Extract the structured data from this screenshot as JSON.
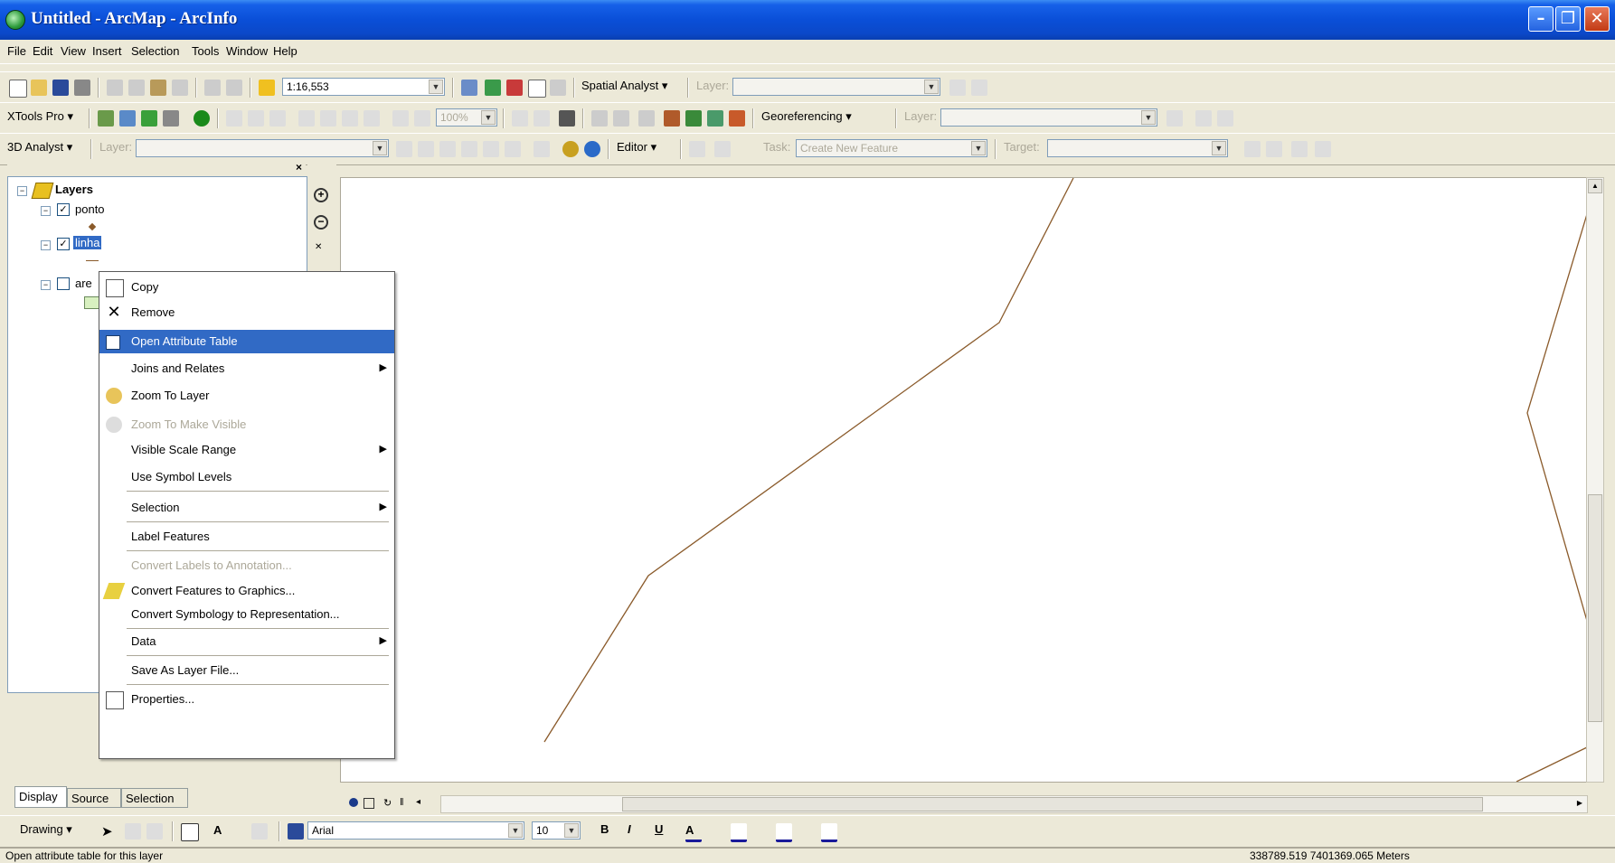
{
  "window": {
    "title": "Untitled - ArcMap - ArcInfo"
  },
  "menubar": [
    "File",
    "Edit",
    "View",
    "Insert",
    "Selection",
    "Tools",
    "Window",
    "Help"
  ],
  "standard_toolbar": {
    "scale": "1:16,553",
    "spatial_analyst": "Spatial Analyst",
    "layer_label": "Layer:"
  },
  "xtools_toolbar": {
    "xtools": "XTools Pro",
    "zoom_pct": "100%",
    "georeferencing": "Georeferencing",
    "layer_label": "Layer:"
  },
  "analyst_toolbar": {
    "analyst": "3D Analyst",
    "layer_label": "Layer:",
    "editor": "Editor",
    "task_label": "Task:",
    "task_value": "Create New Feature",
    "target_label": "Target:"
  },
  "toc": {
    "root": "Layers",
    "layers": [
      {
        "name": "ponto",
        "checked": true
      },
      {
        "name": "linha",
        "checked": true,
        "selected": true
      },
      {
        "name": "are",
        "checked": false
      }
    ],
    "tabs": [
      "Display",
      "Source",
      "Selection"
    ]
  },
  "context_menu": {
    "items": [
      {
        "label": "Copy",
        "icon": "copy-icon"
      },
      {
        "label": "Remove",
        "icon": "remove-x-icon"
      },
      {
        "label": "Open Attribute Table",
        "icon": "table-icon",
        "highlighted": true
      },
      {
        "label": "Joins and Relates",
        "submenu": true
      },
      {
        "label": "Zoom To Layer",
        "icon": "zoom-to-layer-icon"
      },
      {
        "label": "Zoom To Make Visible",
        "icon": "zoom-visible-icon",
        "disabled": true
      },
      {
        "label": "Visible Scale Range",
        "submenu": true
      },
      {
        "label": "Use Symbol Levels"
      },
      {
        "label": "Selection",
        "submenu": true
      },
      {
        "label": "Label Features"
      },
      {
        "label": "Convert Labels to Annotation...",
        "disabled": true
      },
      {
        "label": "Convert Features to Graphics...",
        "icon": "convert-graphics-icon"
      },
      {
        "label": "Convert Symbology to Representation..."
      },
      {
        "label": "Data",
        "submenu": true
      },
      {
        "label": "Save As Layer File..."
      },
      {
        "label": "Properties...",
        "icon": "properties-icon"
      }
    ]
  },
  "drawing_toolbar": {
    "drawing": "Drawing",
    "font": "Arial",
    "font_size": "10",
    "bold": "B",
    "italic": "I",
    "underline": "U"
  },
  "status": {
    "message": "Open attribute table for this layer",
    "coords": "338789.519 7401369.065 Meters"
  }
}
